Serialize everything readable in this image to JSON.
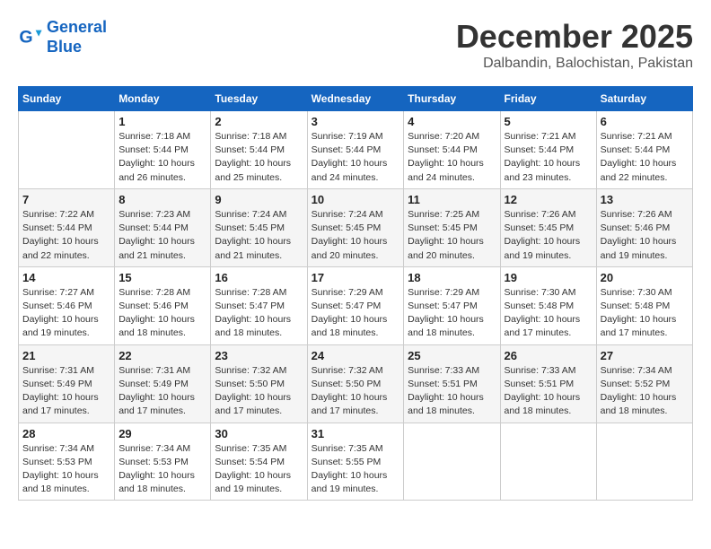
{
  "logo": {
    "line1": "General",
    "line2": "Blue"
  },
  "title": "December 2025",
  "location": "Dalbandin, Balochistan, Pakistan",
  "days_of_week": [
    "Sunday",
    "Monday",
    "Tuesday",
    "Wednesday",
    "Thursday",
    "Friday",
    "Saturday"
  ],
  "weeks": [
    [
      {
        "day": "",
        "info": ""
      },
      {
        "day": "1",
        "info": "Sunrise: 7:18 AM\nSunset: 5:44 PM\nDaylight: 10 hours\nand 26 minutes."
      },
      {
        "day": "2",
        "info": "Sunrise: 7:18 AM\nSunset: 5:44 PM\nDaylight: 10 hours\nand 25 minutes."
      },
      {
        "day": "3",
        "info": "Sunrise: 7:19 AM\nSunset: 5:44 PM\nDaylight: 10 hours\nand 24 minutes."
      },
      {
        "day": "4",
        "info": "Sunrise: 7:20 AM\nSunset: 5:44 PM\nDaylight: 10 hours\nand 24 minutes."
      },
      {
        "day": "5",
        "info": "Sunrise: 7:21 AM\nSunset: 5:44 PM\nDaylight: 10 hours\nand 23 minutes."
      },
      {
        "day": "6",
        "info": "Sunrise: 7:21 AM\nSunset: 5:44 PM\nDaylight: 10 hours\nand 22 minutes."
      }
    ],
    [
      {
        "day": "7",
        "info": "Sunrise: 7:22 AM\nSunset: 5:44 PM\nDaylight: 10 hours\nand 22 minutes."
      },
      {
        "day": "8",
        "info": "Sunrise: 7:23 AM\nSunset: 5:44 PM\nDaylight: 10 hours\nand 21 minutes."
      },
      {
        "day": "9",
        "info": "Sunrise: 7:24 AM\nSunset: 5:45 PM\nDaylight: 10 hours\nand 21 minutes."
      },
      {
        "day": "10",
        "info": "Sunrise: 7:24 AM\nSunset: 5:45 PM\nDaylight: 10 hours\nand 20 minutes."
      },
      {
        "day": "11",
        "info": "Sunrise: 7:25 AM\nSunset: 5:45 PM\nDaylight: 10 hours\nand 20 minutes."
      },
      {
        "day": "12",
        "info": "Sunrise: 7:26 AM\nSunset: 5:45 PM\nDaylight: 10 hours\nand 19 minutes."
      },
      {
        "day": "13",
        "info": "Sunrise: 7:26 AM\nSunset: 5:46 PM\nDaylight: 10 hours\nand 19 minutes."
      }
    ],
    [
      {
        "day": "14",
        "info": "Sunrise: 7:27 AM\nSunset: 5:46 PM\nDaylight: 10 hours\nand 19 minutes."
      },
      {
        "day": "15",
        "info": "Sunrise: 7:28 AM\nSunset: 5:46 PM\nDaylight: 10 hours\nand 18 minutes."
      },
      {
        "day": "16",
        "info": "Sunrise: 7:28 AM\nSunset: 5:47 PM\nDaylight: 10 hours\nand 18 minutes."
      },
      {
        "day": "17",
        "info": "Sunrise: 7:29 AM\nSunset: 5:47 PM\nDaylight: 10 hours\nand 18 minutes."
      },
      {
        "day": "18",
        "info": "Sunrise: 7:29 AM\nSunset: 5:47 PM\nDaylight: 10 hours\nand 18 minutes."
      },
      {
        "day": "19",
        "info": "Sunrise: 7:30 AM\nSunset: 5:48 PM\nDaylight: 10 hours\nand 17 minutes."
      },
      {
        "day": "20",
        "info": "Sunrise: 7:30 AM\nSunset: 5:48 PM\nDaylight: 10 hours\nand 17 minutes."
      }
    ],
    [
      {
        "day": "21",
        "info": "Sunrise: 7:31 AM\nSunset: 5:49 PM\nDaylight: 10 hours\nand 17 minutes."
      },
      {
        "day": "22",
        "info": "Sunrise: 7:31 AM\nSunset: 5:49 PM\nDaylight: 10 hours\nand 17 minutes."
      },
      {
        "day": "23",
        "info": "Sunrise: 7:32 AM\nSunset: 5:50 PM\nDaylight: 10 hours\nand 17 minutes."
      },
      {
        "day": "24",
        "info": "Sunrise: 7:32 AM\nSunset: 5:50 PM\nDaylight: 10 hours\nand 17 minutes."
      },
      {
        "day": "25",
        "info": "Sunrise: 7:33 AM\nSunset: 5:51 PM\nDaylight: 10 hours\nand 18 minutes."
      },
      {
        "day": "26",
        "info": "Sunrise: 7:33 AM\nSunset: 5:51 PM\nDaylight: 10 hours\nand 18 minutes."
      },
      {
        "day": "27",
        "info": "Sunrise: 7:34 AM\nSunset: 5:52 PM\nDaylight: 10 hours\nand 18 minutes."
      }
    ],
    [
      {
        "day": "28",
        "info": "Sunrise: 7:34 AM\nSunset: 5:53 PM\nDaylight: 10 hours\nand 18 minutes."
      },
      {
        "day": "29",
        "info": "Sunrise: 7:34 AM\nSunset: 5:53 PM\nDaylight: 10 hours\nand 18 minutes."
      },
      {
        "day": "30",
        "info": "Sunrise: 7:35 AM\nSunset: 5:54 PM\nDaylight: 10 hours\nand 19 minutes."
      },
      {
        "day": "31",
        "info": "Sunrise: 7:35 AM\nSunset: 5:55 PM\nDaylight: 10 hours\nand 19 minutes."
      },
      {
        "day": "",
        "info": ""
      },
      {
        "day": "",
        "info": ""
      },
      {
        "day": "",
        "info": ""
      }
    ]
  ]
}
